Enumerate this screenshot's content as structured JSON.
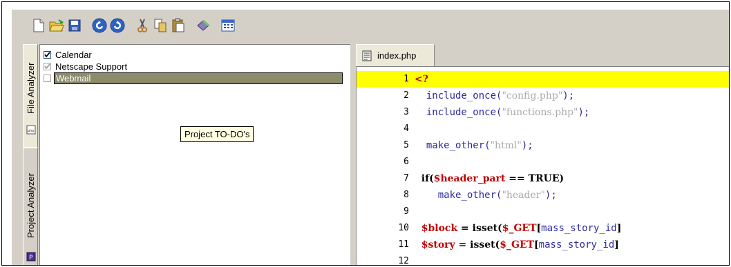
{
  "toolbar": {
    "buttons": [
      "new-file",
      "open-folder",
      "save",
      "undo",
      "redo",
      "cut",
      "copy",
      "paste",
      "tool",
      "window"
    ]
  },
  "side_tabs": {
    "file_analyzer": "File Analyzer",
    "project_analyzer": "Project Analyzer"
  },
  "tree": {
    "items": [
      {
        "label": "Calendar",
        "checked": true
      },
      {
        "label": "Netscape Support",
        "checked": true
      },
      {
        "label": "Webmail",
        "checked": false
      }
    ]
  },
  "tooltip": "Project TO-DO's",
  "editor": {
    "tab_label": "index.php",
    "lines": [
      {
        "n": "1",
        "parts": [
          [
            "red",
            "<?"
          ]
        ],
        "highlight": true
      },
      {
        "n": "2",
        "parts": [
          [
            "fn",
            "  include_once("
          ],
          [
            "str",
            "\"config.php\""
          ],
          [
            "fn",
            ");"
          ]
        ]
      },
      {
        "n": "3",
        "parts": [
          [
            "fn",
            "  include_once("
          ],
          [
            "str",
            "\"functions.php\""
          ],
          [
            "fn",
            ");"
          ]
        ]
      },
      {
        "n": "4",
        "parts": []
      },
      {
        "n": "5",
        "parts": [
          [
            "fn",
            "  make_other("
          ],
          [
            "str",
            "\"html\""
          ],
          [
            "fn",
            ");"
          ]
        ]
      },
      {
        "n": "6",
        "parts": []
      },
      {
        "n": "7",
        "parts": [
          [
            "kw",
            "  if("
          ],
          [
            "var",
            "$header_part"
          ],
          [
            "kw",
            " == TRUE)"
          ]
        ]
      },
      {
        "n": "8",
        "parts": [
          [
            "fn",
            "    make_other("
          ],
          [
            "str",
            "\"header\""
          ],
          [
            "fn",
            ");"
          ]
        ]
      },
      {
        "n": "9",
        "parts": []
      },
      {
        "n": "10",
        "parts": [
          [
            "var",
            "  $block"
          ],
          [
            "kw",
            " = isset("
          ],
          [
            "var",
            "$_GET"
          ],
          [
            "kw",
            "["
          ],
          [
            "bl",
            "mass_story_id"
          ],
          [
            "kw",
            "]"
          ]
        ]
      },
      {
        "n": "11",
        "parts": [
          [
            "var",
            "  $story"
          ],
          [
            "kw",
            " = isset("
          ],
          [
            "var",
            "$_GET"
          ],
          [
            "kw",
            "["
          ],
          [
            "bl",
            "mass_story_id"
          ],
          [
            "kw",
            "]"
          ]
        ]
      },
      {
        "n": "12",
        "parts": []
      }
    ]
  }
}
